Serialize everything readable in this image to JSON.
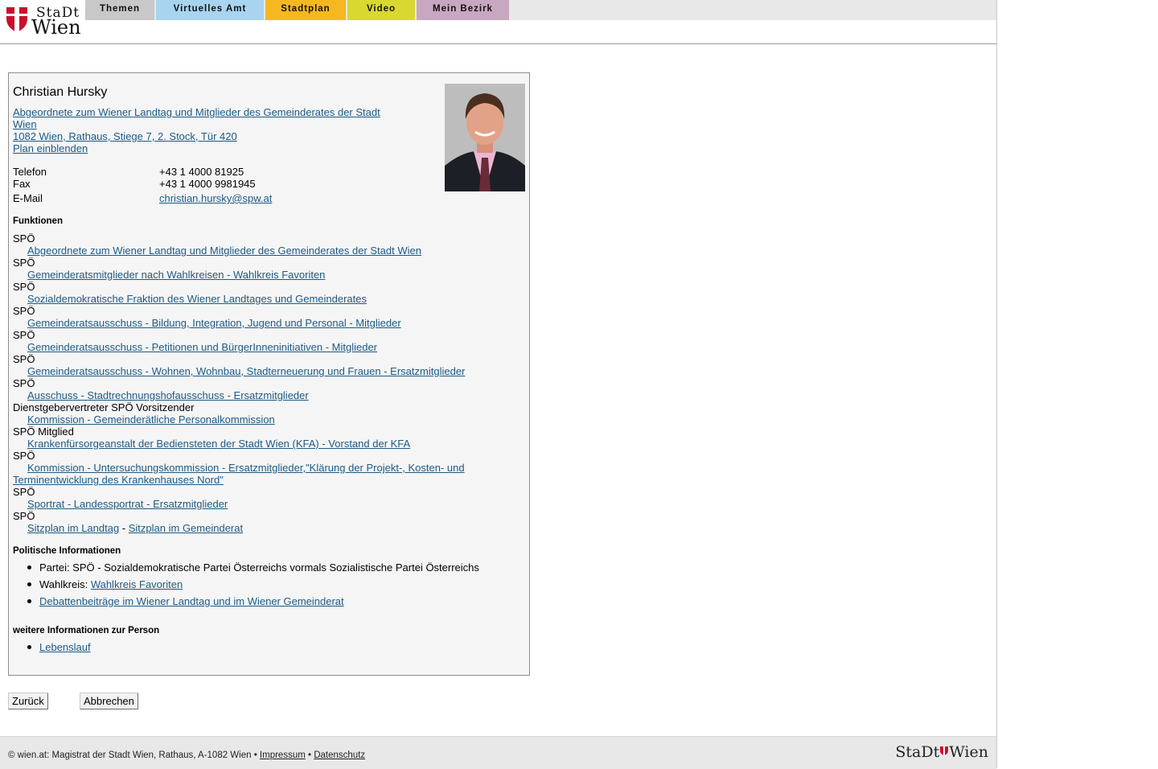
{
  "logo": {
    "stadt": "StaDt",
    "wien": "Wien"
  },
  "nav": [
    {
      "label": "Themen",
      "color": "#c8c8c8"
    },
    {
      "label": "Virtuelles Amt",
      "color": "#a8d4f0"
    },
    {
      "label": "Stadtplan",
      "color": "#f5b820"
    },
    {
      "label": "Video",
      "color": "#d8d830"
    },
    {
      "label": "Mein Bezirk",
      "color": "#c8a8c0"
    }
  ],
  "person": {
    "name": "Christian Hursky",
    "role_line1": "Abgeordnete zum Wiener Landtag und Mitglieder des Gemeinderates der Stadt",
    "role_line2": "Wien ",
    "address": "1082 Wien, Rathaus, Stiege 7, 2. Stock, Tür 420",
    "map_link": "Plan einblenden",
    "phone_label": "Telefon",
    "phone": "+43 1 4000 81925",
    "fax_label": "Fax",
    "fax": "+43 1 4000 9981945",
    "email_label": "E-Mail",
    "email": "christian.hursky@spw.at"
  },
  "functions": {
    "title": "Funktionen",
    "items": [
      {
        "label": "SPÖ",
        "link": "Abgeordnete zum Wiener Landtag und Mitglieder des Gemeinderates der Stadt Wien"
      },
      {
        "label": "SPÖ",
        "link": "Gemeinderatsmitglieder nach Wahlkreisen - Wahlkreis Favoriten"
      },
      {
        "label": "SPÖ",
        "link": "Sozialdemokratische Fraktion des Wiener Landtages und Gemeinderates"
      },
      {
        "label": "SPÖ",
        "link": "Gemeinderatsausschuss - Bildung, Integration, Jugend und Personal - Mitglieder"
      },
      {
        "label": "SPÖ",
        "link": "Gemeinderatsausschuss - Petitionen und BürgerInneninitiativen - Mitglieder"
      },
      {
        "label": "SPÖ",
        "link": "Gemeinderatsausschuss - Wohnen, Wohnbau, Stadterneuerung und Frauen - Ersatzmitglieder"
      },
      {
        "label": "SPÖ",
        "link": "Ausschuss - Stadtrechnungshofausschuss - Ersatzmitglieder"
      },
      {
        "label": "Dienstgebervertreter SPÖ Vorsitzender",
        "link": "Kommission - Gemeinderätliche Personalkommission"
      },
      {
        "label": "SPÖ Mitglied",
        "link": "Krankenfürsorgeanstalt der Bediensteten der Stadt Wien (KFA) - Vorstand der KFA"
      },
      {
        "label": "SPÖ",
        "link": "Kommission - Untersuchungskommission - Ersatzmitglieder,\"Klärung der Projekt-, Kosten- und Terminentwicklung des Krankenhauses Nord\""
      },
      {
        "label": "SPÖ",
        "link": "Sportrat - Landessportrat - Ersatzmitglieder"
      }
    ],
    "last_label": "SPÖ",
    "seat_landtag": "Sitzplan im Landtag",
    "seat_sep": " - ",
    "seat_gemeinderat": "Sitzplan im Gemeinderat"
  },
  "political": {
    "title": "Politische Informationen",
    "party": "Partei: SPÖ - Sozialdemokratische Partei Österreichs vormals Sozialistische Partei Österreichs",
    "district_label": "Wahlkreis: ",
    "district_link": "Wahlkreis Favoriten",
    "debates_link": "Debattenbeiträge im Wiener Landtag und im Wiener Gemeinderat"
  },
  "more": {
    "title": "weitere Informationen zur Person",
    "cv_link": "Lebenslauf"
  },
  "buttons": {
    "back": "Zurück",
    "cancel": "Abbrechen"
  },
  "footer": {
    "copyright": "© wien.at: Magistrat der Stadt Wien, Rathaus, A-1082 Wien • ",
    "impressum": "Impressum",
    "sep": " • ",
    "datenschutz": "Datenschutz",
    "logo_stadt": "StaDt",
    "logo_wien": "Wien"
  }
}
